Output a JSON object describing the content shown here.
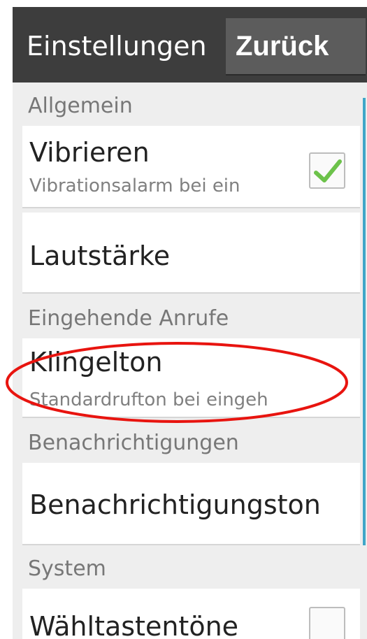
{
  "header": {
    "title": "Einstellungen",
    "back_label": "Zurück"
  },
  "sections": {
    "general": {
      "header": "Allgemein",
      "vibrate": {
        "title": "Vibrieren",
        "subtitle": "Vibrationsalarm bei ein",
        "checked": true
      },
      "volume": {
        "title": "Lautstärke"
      }
    },
    "incoming_calls": {
      "header": "Eingehende Anrufe",
      "ringtone": {
        "title": "Klingelton",
        "subtitle": "Standardrufton bei eingeh"
      }
    },
    "notifications": {
      "header": "Benachrichtigungen",
      "notification_tone": {
        "title": "Benachrichtigungston"
      }
    },
    "system": {
      "header": "System",
      "dial_tones": {
        "title": "Wähltastentöne",
        "checked": false
      }
    }
  },
  "colors": {
    "action_bar": "#3d3d3d",
    "back_button": "#5c5c5c",
    "scrollbar": "#3fa6c8",
    "check_mark": "#6cc24a",
    "annotation": "#e8140f"
  },
  "icons": {
    "check": "check-mark-icon"
  }
}
